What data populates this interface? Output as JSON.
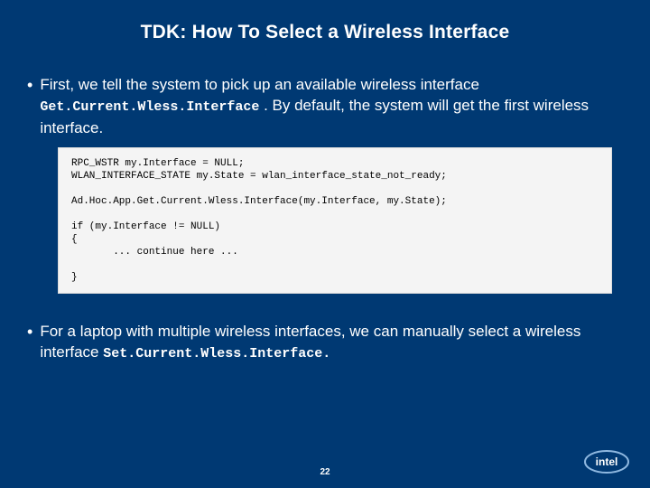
{
  "title": "TDK: How To Select a Wireless Interface",
  "bullets": {
    "b1_pre": "First, we tell the system to pick up an available wireless interface ",
    "b1_code": "Get.Current.Wless.Interface",
    "b1_post": " . By default, the system will get the first wireless interface.",
    "b2_pre": "For a laptop with multiple wireless interfaces, we can manually select a wireless interface ",
    "b2_code": "Set.Current.Wless.Interface.",
    "b2_post": ""
  },
  "code_lines": {
    "l0": "RPC_WSTR my.Interface = NULL;",
    "l1": "WLAN_INTERFACE_STATE my.State = wlan_interface_state_not_ready;",
    "l2": "",
    "l3": "Ad.Hoc.App.Get.Current.Wless.Interface(my.Interface, my.State);",
    "l4": "",
    "l5": "if (my.Interface != NULL)",
    "l6": "{",
    "l7": "       ... continue here ...",
    "l8": "",
    "l9": "}"
  },
  "page_number": "22",
  "logo_text": "intel"
}
